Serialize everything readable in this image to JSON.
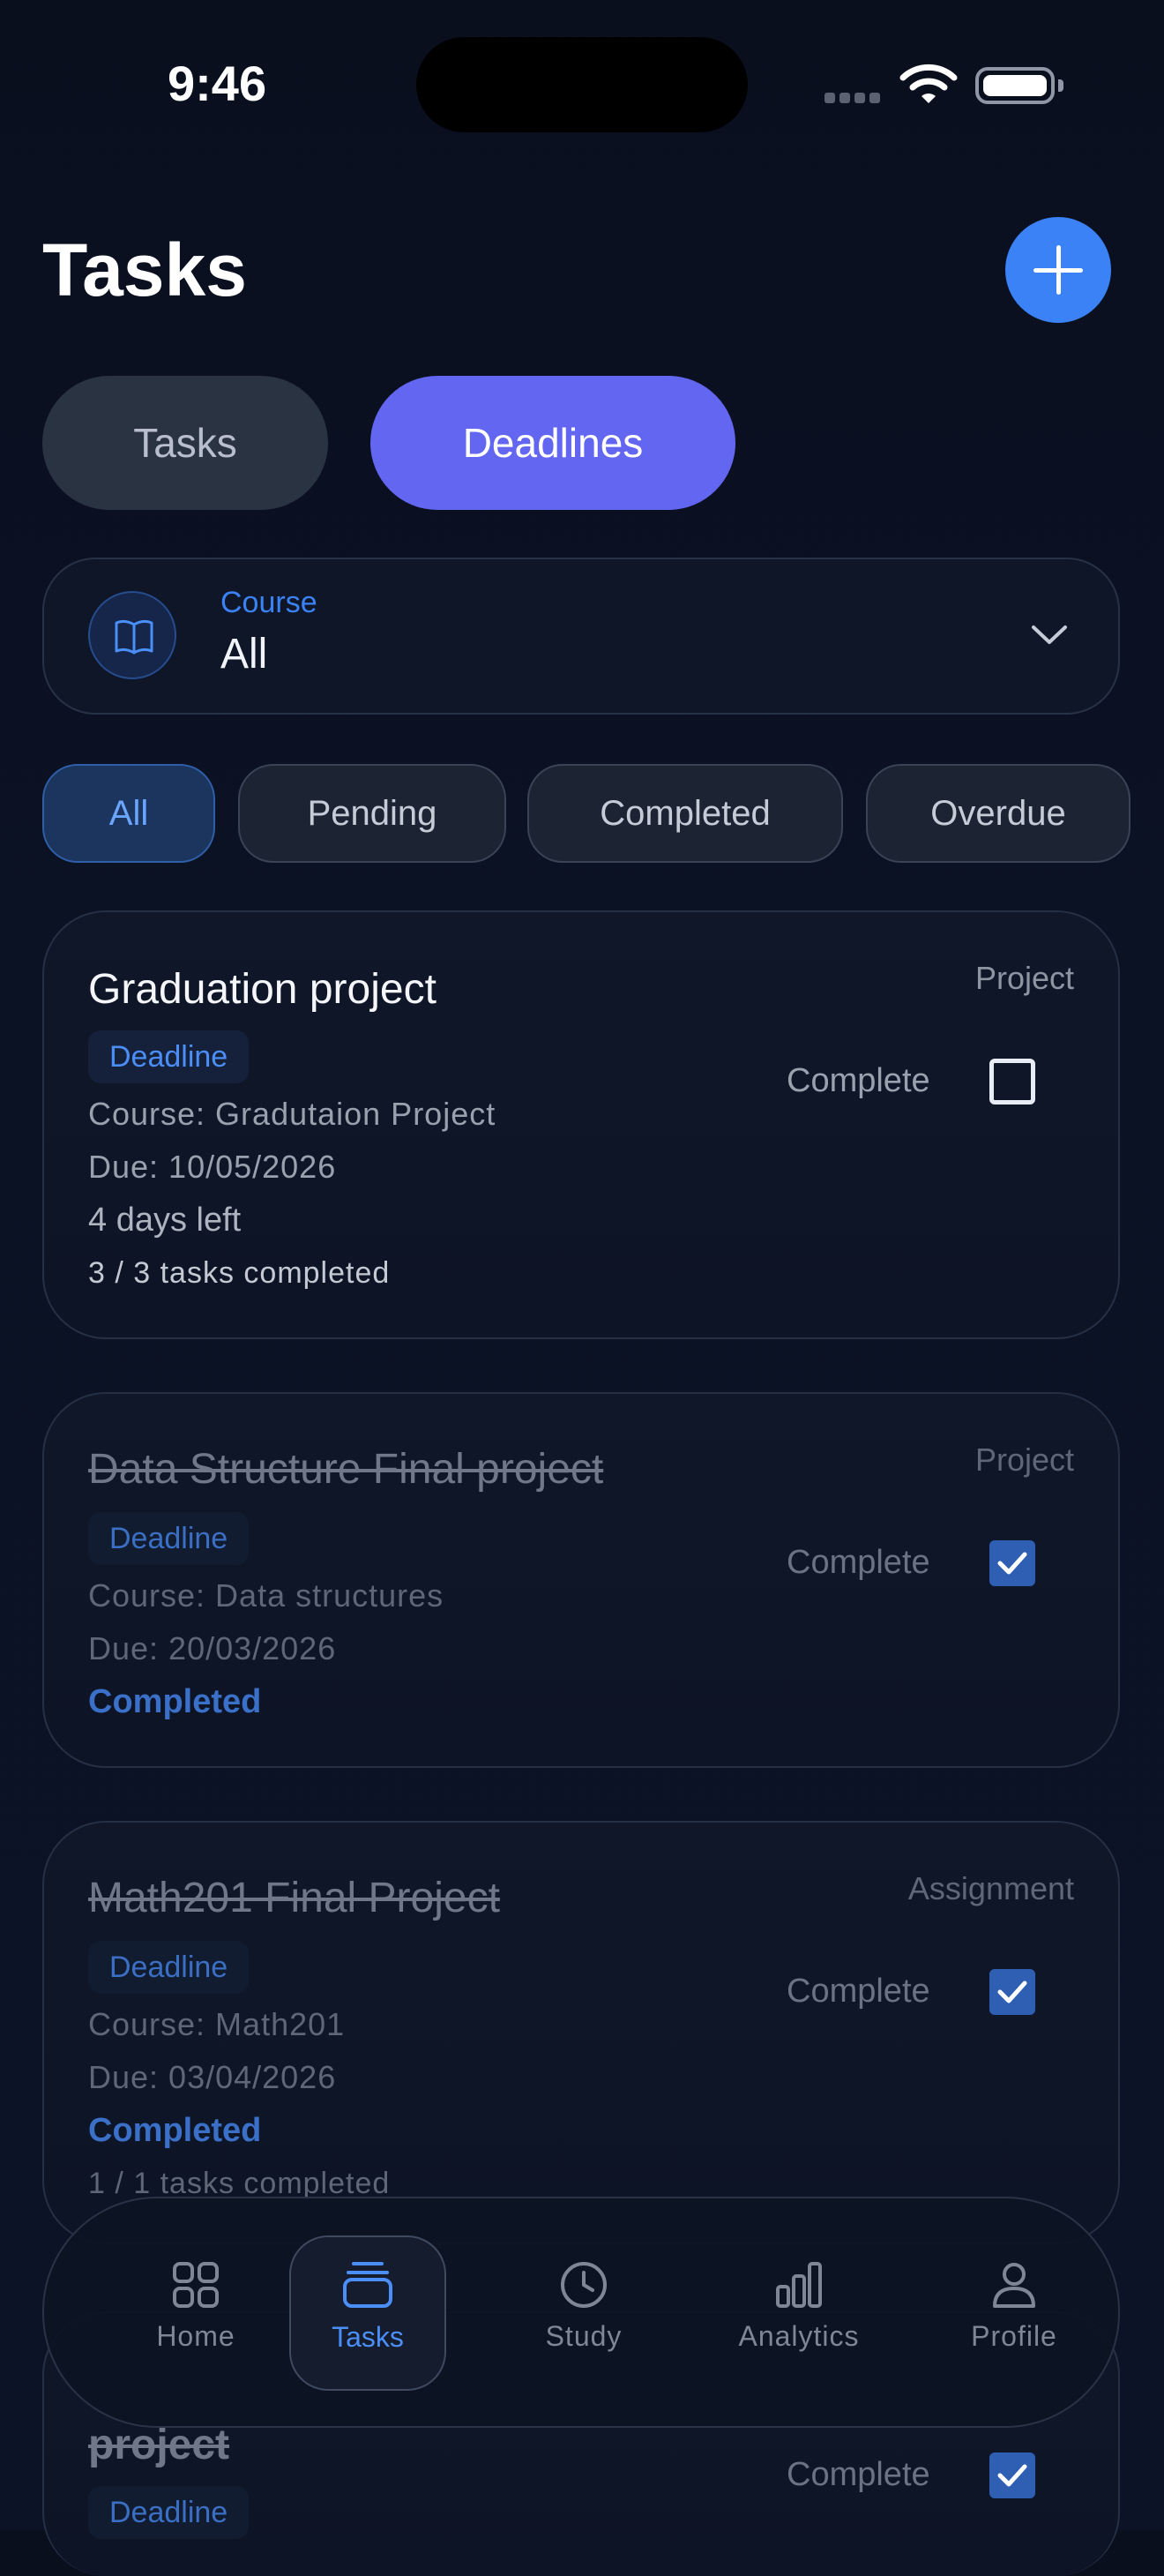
{
  "status_bar": {
    "time": "9:46"
  },
  "header": {
    "title": "Tasks",
    "add_icon": "plus-icon"
  },
  "segments": [
    {
      "label": "Tasks",
      "selected": false
    },
    {
      "label": "Deadlines",
      "selected": true
    }
  ],
  "course_selector": {
    "label": "Course",
    "value": "All",
    "icon": "book-icon"
  },
  "filters": [
    {
      "label": "All",
      "selected": true
    },
    {
      "label": "Pending",
      "selected": false
    },
    {
      "label": "Completed",
      "selected": false
    },
    {
      "label": "Overdue",
      "selected": false
    }
  ],
  "cards": [
    {
      "title": "Graduation project",
      "badge": "Deadline",
      "course": "Course: Gradutaion Project",
      "due": "Due: 10/05/2026",
      "days_left": "4 days left",
      "progress": "3 / 3 tasks completed",
      "type": "Project",
      "complete_label": "Complete",
      "checked": false
    },
    {
      "title": "Data Structure Final project",
      "badge": "Deadline",
      "course": "Course: Data structures",
      "due": "Due: 20/03/2026",
      "status": "Completed",
      "type": "Project",
      "complete_label": "Complete",
      "checked": true
    },
    {
      "title": "Math201 Final Project",
      "badge": "Deadline",
      "course": "Course: Math201",
      "due": "Due: 03/04/2026",
      "status": "Completed",
      "progress": "1 / 1 tasks completed",
      "type": "Assignment",
      "complete_label": "Complete",
      "checked": true
    },
    {
      "title": "project",
      "badge": "Deadline",
      "complete_label": "Complete",
      "checked": true
    }
  ],
  "nav": [
    {
      "label": "Home",
      "icon": "grid-icon",
      "active": false
    },
    {
      "label": "Tasks",
      "icon": "stack-icon",
      "active": true
    },
    {
      "label": "Study",
      "icon": "clock-icon",
      "active": false
    },
    {
      "label": "Analytics",
      "icon": "bar-chart-icon",
      "active": false
    },
    {
      "label": "Profile",
      "icon": "person-icon",
      "active": false
    }
  ],
  "colors": {
    "accent": "#3b82f6",
    "segment_active": "#6366f1",
    "background": "#0a0f1e"
  }
}
